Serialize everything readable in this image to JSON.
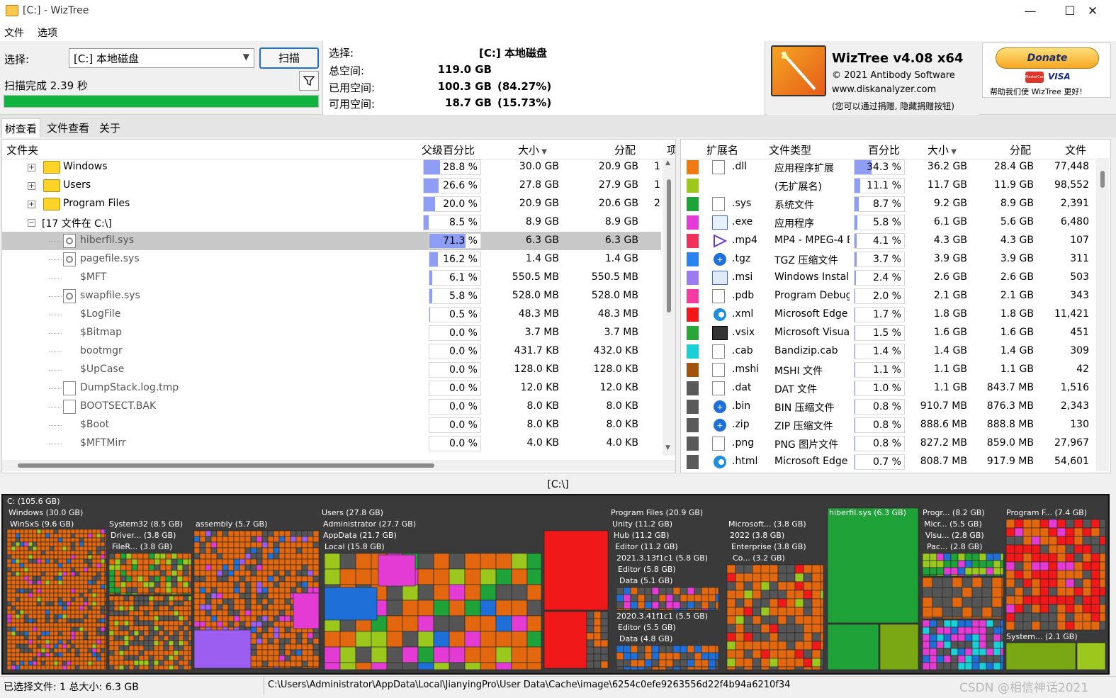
{
  "window": {
    "title": "[C:]  - WizTree",
    "min": "—",
    "max": "☐",
    "close": "✕"
  },
  "menu": [
    "文件",
    "选项"
  ],
  "top": {
    "select_label": "选择:",
    "drive_value": "[C:] 本地磁盘",
    "scan_label": "扫描",
    "scan_status": "扫描完成 2.39 秒",
    "progress": 1.0,
    "info": {
      "select_label": "选择:",
      "select_value": "[C:]  本地磁盘",
      "total_label": "总空间:",
      "total_value": "119.0 GB",
      "used_label": "已用空间:",
      "used_value": "100.3 GB",
      "used_pct": "(84.27%)",
      "free_label": "可用空间:",
      "free_value": "18.7 GB",
      "free_pct": "(15.73%)"
    },
    "app_name": "WizTree v4.08 x64",
    "copyright": "© 2021 Antibody Software",
    "website": "www.diskanalyzer.com",
    "donate_hint": "(您可以通过捐赠, 隐藏捐赠按钮)",
    "donate_label": "Donate",
    "donate_help": "帮助我们使 WizTree 更好!",
    "visa": "VISA",
    "mastercard": "MasterCard"
  },
  "tabs": [
    "树查看",
    "文件查看",
    "关于"
  ],
  "tree": {
    "headers": {
      "folder": "文件夹",
      "pct": "父级百分比",
      "size": "大小",
      "alloc": "分配",
      "items": "项"
    },
    "rows": [
      {
        "name": "Windows",
        "type": "folder",
        "pct": "28.8 %",
        "pctv": 28.8,
        "size": "30.0 GB",
        "alloc": "20.9 GB",
        "items": "1"
      },
      {
        "name": "Users",
        "type": "folder",
        "pct": "26.6 %",
        "pctv": 26.6,
        "size": "27.8 GB",
        "alloc": "27.9 GB",
        "items": "1"
      },
      {
        "name": "Program Files",
        "type": "folder",
        "pct": "20.0 %",
        "pctv": 20.0,
        "size": "20.9 GB",
        "alloc": "20.6 GB",
        "items": "2"
      },
      {
        "name": "[17 文件在 C:\\]",
        "type": "group",
        "pct": "8.5 %",
        "pctv": 8.5,
        "size": "8.9 GB",
        "alloc": "8.9 GB",
        "items": ""
      },
      {
        "name": "hiberfil.sys",
        "type": "sys",
        "pct": "71.3 %",
        "pctv": 71.3,
        "size": "6.3 GB",
        "alloc": "6.3 GB",
        "items": "",
        "selected": true
      },
      {
        "name": "pagefile.sys",
        "type": "sys",
        "pct": "16.2 %",
        "pctv": 16.2,
        "size": "1.4 GB",
        "alloc": "1.4 GB",
        "items": ""
      },
      {
        "name": "$MFT",
        "type": "none",
        "pct": "6.1 %",
        "pctv": 6.1,
        "size": "550.5 MB",
        "alloc": "550.5 MB",
        "items": ""
      },
      {
        "name": "swapfile.sys",
        "type": "sys",
        "pct": "5.8 %",
        "pctv": 5.8,
        "size": "528.0 MB",
        "alloc": "528.0 MB",
        "items": ""
      },
      {
        "name": "$LogFile",
        "type": "none",
        "pct": "0.5 %",
        "pctv": 0.5,
        "size": "48.3 MB",
        "alloc": "48.3 MB",
        "items": ""
      },
      {
        "name": "$Bitmap",
        "type": "none",
        "pct": "0.0 %",
        "pctv": 0,
        "size": "3.7 MB",
        "alloc": "3.7 MB",
        "items": ""
      },
      {
        "name": "bootmgr",
        "type": "none",
        "pct": "0.0 %",
        "pctv": 0,
        "size": "431.7 KB",
        "alloc": "432.0 KB",
        "items": ""
      },
      {
        "name": "$UpCase",
        "type": "none",
        "pct": "0.0 %",
        "pctv": 0,
        "size": "128.0 KB",
        "alloc": "128.0 KB",
        "items": ""
      },
      {
        "name": "DumpStack.log.tmp",
        "type": "file",
        "pct": "0.0 %",
        "pctv": 0,
        "size": "12.0 KB",
        "alloc": "12.0 KB",
        "items": ""
      },
      {
        "name": "BOOTSECT.BAK",
        "type": "file",
        "pct": "0.0 %",
        "pctv": 0,
        "size": "8.0 KB",
        "alloc": "8.0 KB",
        "items": ""
      },
      {
        "name": "$Boot",
        "type": "none",
        "pct": "0.0 %",
        "pctv": 0,
        "size": "8.0 KB",
        "alloc": "8.0 KB",
        "items": ""
      },
      {
        "name": "$MFTMirr",
        "type": "none",
        "pct": "0.0 %",
        "pctv": 0,
        "size": "4.0 KB",
        "alloc": "4.0 KB",
        "items": ""
      }
    ]
  },
  "ext": {
    "headers": {
      "ext": "扩展名",
      "type": "文件类型",
      "pct": "百分比",
      "size": "大小",
      "alloc": "分配",
      "files": "文件"
    },
    "rows": [
      {
        "color": "#f07a12",
        "icon": "gear",
        "ext": ".dll",
        "type": "应用程序扩展",
        "pct": "34.3 %",
        "pctv": 34.3,
        "size": "36.2 GB",
        "alloc": "28.4 GB",
        "files": "77,448"
      },
      {
        "color": "#9cc81e",
        "icon": "none",
        "ext": "",
        "type": "(无扩展名)",
        "pct": "11.1 %",
        "pctv": 11.1,
        "size": "11.7 GB",
        "alloc": "11.9 GB",
        "files": "98,552"
      },
      {
        "color": "#1fa339",
        "icon": "gear",
        "ext": ".sys",
        "type": "系统文件",
        "pct": "8.7 %",
        "pctv": 8.7,
        "size": "9.2 GB",
        "alloc": "8.9 GB",
        "files": "2,391"
      },
      {
        "color": "#e43bd5",
        "icon": "exe",
        "ext": ".exe",
        "type": "应用程序",
        "pct": "5.8 %",
        "pctv": 5.8,
        "size": "6.1 GB",
        "alloc": "5.6 GB",
        "files": "6,480"
      },
      {
        "color": "#f0325a",
        "icon": "play",
        "ext": ".mp4",
        "type": "MP4 - MPEG-4 E",
        "pct": "4.1 %",
        "pctv": 4.1,
        "size": "4.3 GB",
        "alloc": "4.3 GB",
        "files": "107"
      },
      {
        "color": "#2a83f0",
        "icon": "zip",
        "ext": ".tgz",
        "type": "TGZ 压缩文件",
        "pct": "3.7 %",
        "pctv": 3.7,
        "size": "3.9 GB",
        "alloc": "3.9 GB",
        "files": "311"
      },
      {
        "color": "#9b7cf0",
        "icon": "msi",
        "ext": ".msi",
        "type": "Windows Installe",
        "pct": "2.4 %",
        "pctv": 2.4,
        "size": "2.6 GB",
        "alloc": "2.6 GB",
        "files": "503"
      },
      {
        "color": "#f23ca0",
        "icon": "file",
        "ext": ".pdb",
        "type": "Program Debug",
        "pct": "2.0 %",
        "pctv": 2.0,
        "size": "2.1 GB",
        "alloc": "2.1 GB",
        "files": "343"
      },
      {
        "color": "#f01818",
        "icon": "edge",
        "ext": ".xml",
        "type": "Microsoft Edge I",
        "pct": "1.7 %",
        "pctv": 1.7,
        "size": "1.8 GB",
        "alloc": "1.8 GB",
        "files": "11,421"
      },
      {
        "color": "#2aa638",
        "icon": "vsix",
        "ext": ".vsix",
        "type": "Microsoft Visual",
        "pct": "1.5 %",
        "pctv": 1.5,
        "size": "1.6 GB",
        "alloc": "1.6 GB",
        "files": "451"
      },
      {
        "color": "#1ad0d8",
        "icon": "file",
        "ext": ".cab",
        "type": "Bandizip.cab",
        "pct": "1.4 %",
        "pctv": 1.4,
        "size": "1.4 GB",
        "alloc": "1.4 GB",
        "files": "309"
      },
      {
        "color": "#a0520e",
        "icon": "file",
        "ext": ".mshi",
        "type": "MSHI 文件",
        "pct": "1.1 %",
        "pctv": 1.1,
        "size": "1.1 GB",
        "alloc": "1.1 GB",
        "files": "42"
      },
      {
        "color": "#5a5a5a",
        "icon": "file",
        "ext": ".dat",
        "type": "DAT 文件",
        "pct": "1.0 %",
        "pctv": 1.0,
        "size": "1.1 GB",
        "alloc": "843.7 MB",
        "files": "1,516"
      },
      {
        "color": "#5a5a5a",
        "icon": "zip",
        "ext": ".bin",
        "type": "BIN 压缩文件",
        "pct": "0.8 %",
        "pctv": 0.8,
        "size": "910.7 MB",
        "alloc": "876.3 MB",
        "files": "2,343"
      },
      {
        "color": "#5a5a5a",
        "icon": "zip",
        "ext": ".zip",
        "type": "ZIP 压缩文件",
        "pct": "0.8 %",
        "pctv": 0.8,
        "size": "888.6 MB",
        "alloc": "888.8 MB",
        "files": "130"
      },
      {
        "color": "#5a5a5a",
        "icon": "file",
        "ext": ".png",
        "type": "PNG 图片文件",
        "pct": "0.8 %",
        "pctv": 0.8,
        "size": "827.2 MB",
        "alloc": "859.0 MB",
        "files": "27,967"
      },
      {
        "color": "#5a5a5a",
        "icon": "edge",
        "ext": ".html",
        "type": "Microsoft Edge I",
        "pct": "0.7 %",
        "pctv": 0.7,
        "size": "808.7 MB",
        "alloc": "917.9 MB",
        "files": "54,601"
      }
    ]
  },
  "path": "[C:\\]",
  "treemap_labels": {
    "root": "C: (105.6 GB)",
    "windows": "Windows (30.0 GB)",
    "winsxs": "WinSxS (9.6 GB)",
    "system32": "System32 (8.5 GB)",
    "driver": "Driver... (3.8 GB)",
    "filer": "FileR... (3.8 GB)",
    "assembly": "assembly (5.7 GB)",
    "users": "Users (27.8 GB)",
    "admin": "Administrator (27.7 GB)",
    "appdata": "AppData (21.7 GB)",
    "local": "Local (15.8 GB)",
    "progfiles": "Program Files (20.9 GB)",
    "unity": "Unity (11.2 GB)",
    "hub": "Hub (11.2 GB)",
    "editor": "Editor (11.2 GB)",
    "u2021": "2021.3.13f1c1 (5.8 GB)",
    "ed58": "Editor (5.8 GB)",
    "data51": "Data (5.1 GB)",
    "u2020": "2020.3.41f1c1 (5.5 GB)",
    "ed55": "Editor (5.5 GB)",
    "data48": "Data (4.8 GB)",
    "ms": "Microsoft... (3.8 GB)",
    "y2022": "2022 (3.8 GB)",
    "ent": "Enterprise (3.8 GB)",
    "co": "Co... (3.2 GB)",
    "hiber": "hiberfil.sys (6.3 GB)",
    "progr": "Progr... (8.2 GB)",
    "micr": "Micr... (5.5 GB)",
    "visu": "Visu... (2.8 GB)",
    "pac": "Pac... (2.8 GB)",
    "progf": "Program F... (7.4 GB)",
    "system": "System... (2.1 GB)"
  },
  "status": {
    "selected": "已选择文件: 1  总大小: 6.3 GB",
    "filepath": "C:\\Users\\Administrator\\AppData\\Local\\JianyingPro\\User Data\\Cache\\image\\6254c0efe9263556d22f4b94a6210f34",
    "watermark": "CSDN @相信神话2021"
  }
}
